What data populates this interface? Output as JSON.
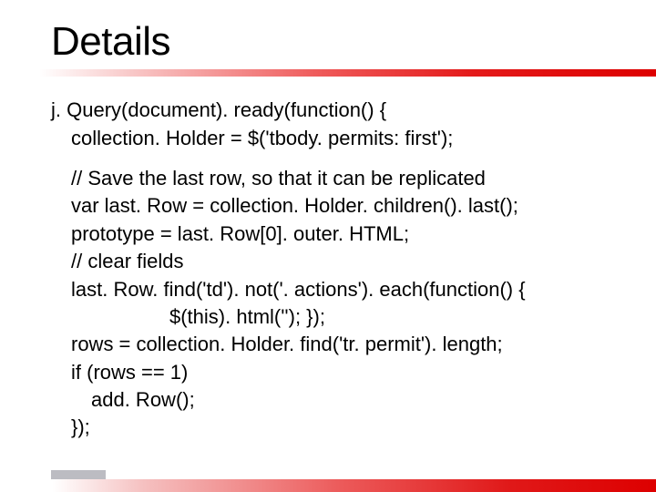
{
  "slide": {
    "title": "Details",
    "code": {
      "line1": "j. Query(document). ready(function() {",
      "line2": "collection. Holder = $('tbody. permits: first');",
      "line3": "// Save the last row, so that it can be replicated",
      "line4": "var last. Row = collection. Holder. children(). last();",
      "line5": "prototype = last. Row[0]. outer. HTML;",
      "line6": "// clear fields",
      "line7": "last. Row. find('td'). not('. actions'). each(function() {",
      "line8": "$(this). html(''); });",
      "line9": "rows = collection. Holder. find('tr. permit'). length;",
      "line10": "if (rows == 1)",
      "line11": "add. Row();",
      "line12": "});"
    }
  }
}
